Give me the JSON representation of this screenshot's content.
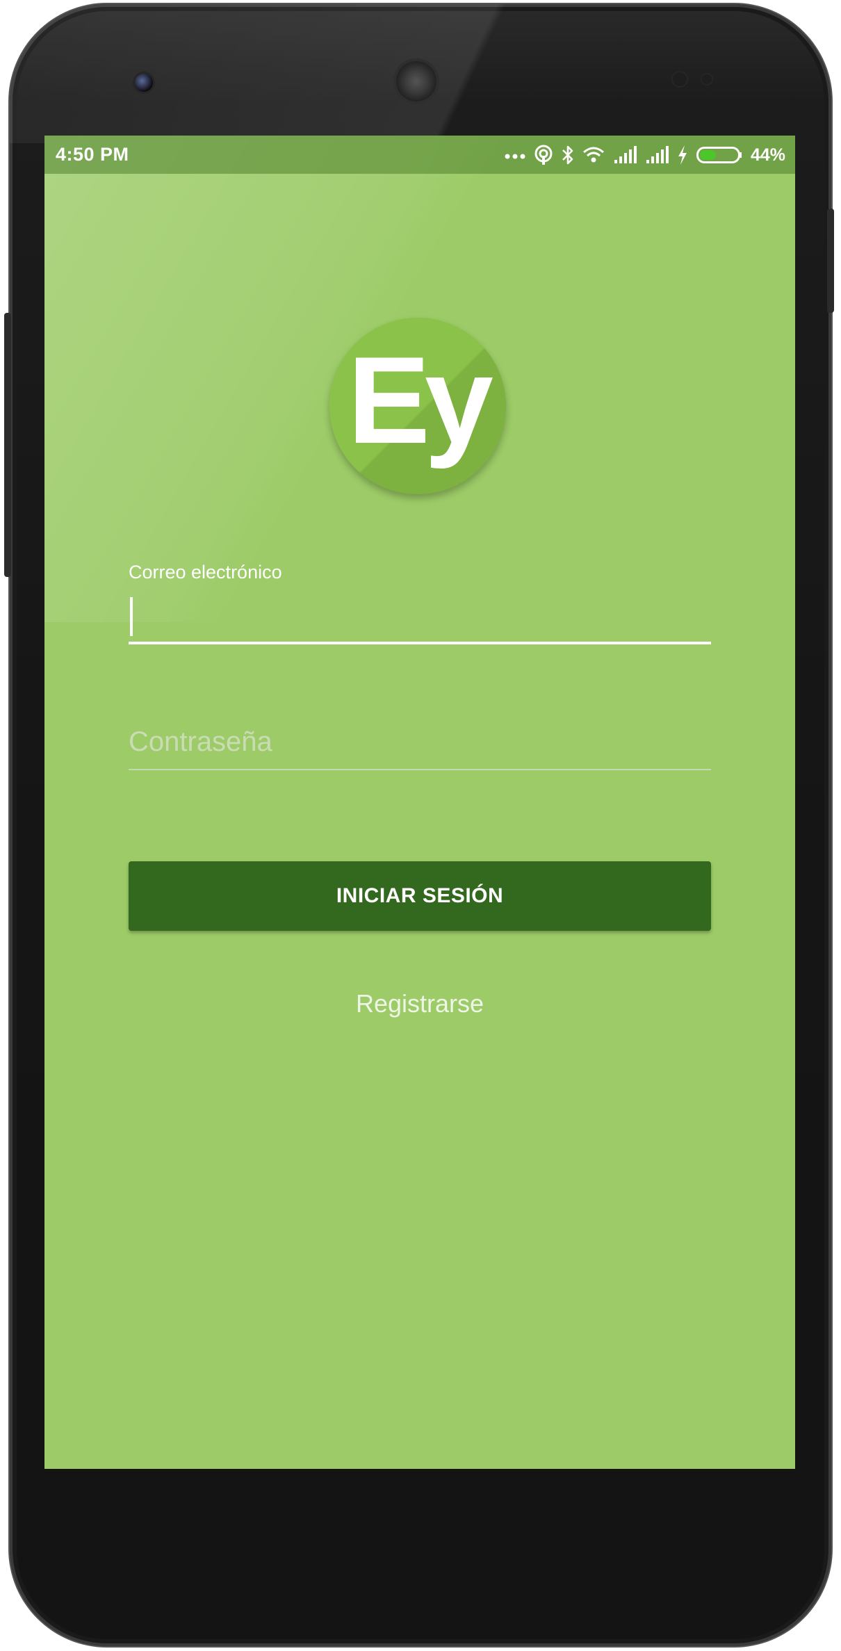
{
  "status_bar": {
    "time": "4:50 PM",
    "battery_percent": "44%",
    "battery_level": 0.44,
    "icons": [
      "more-dots-icon",
      "hotspot-icon",
      "bluetooth-icon",
      "wifi-icon",
      "signal-icon",
      "signal-icon",
      "charging-bolt-icon",
      "battery-icon"
    ]
  },
  "logo": {
    "text": "Ey",
    "color": "#8bc34a"
  },
  "login_form": {
    "email_label": "Correo electrónico",
    "email_value": "",
    "password_placeholder": "Contraseña",
    "login_button_label": "INICIAR SESIÓN",
    "register_link_label": "Registrarse"
  },
  "colors": {
    "background": "#9ccb67",
    "button": "#33691e",
    "status_bar": "#6a9b3f"
  }
}
